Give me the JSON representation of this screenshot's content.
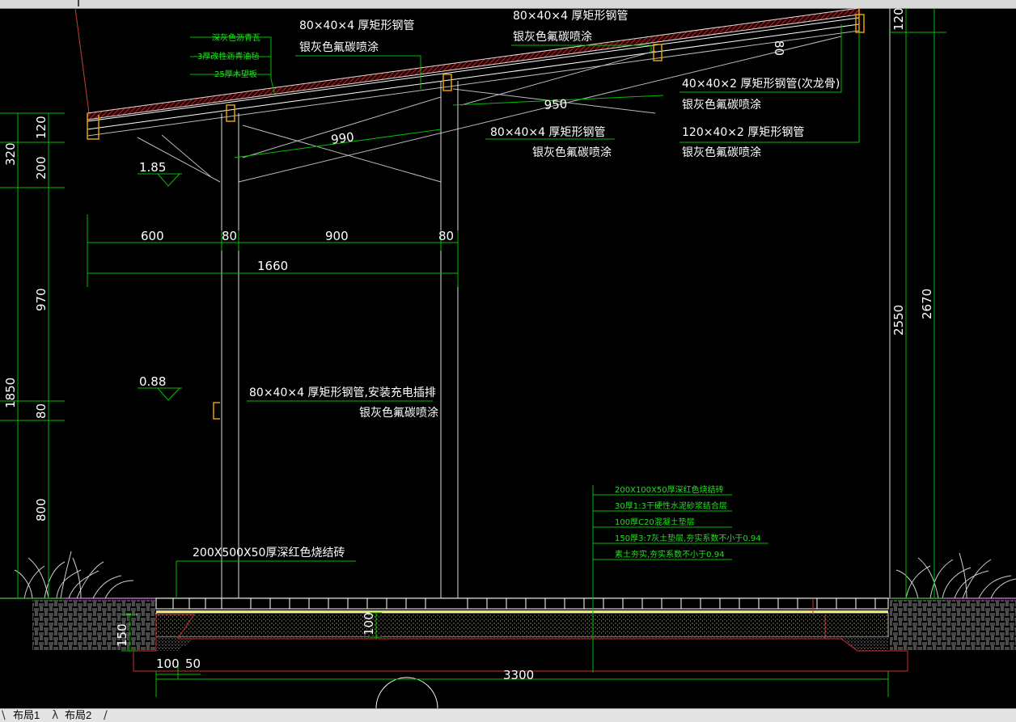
{
  "labels": {
    "roof_layer1": "深灰色沥青瓦",
    "roof_layer2": "3厚改性沥青油毡",
    "roof_layer3": "25厚木望板",
    "tube_main_top_left": "80×40×4 厚矩形钢管",
    "tube_main_top_left_sub": "银灰色氟碳喷涂",
    "tube_main_top_right": "80×40×4 厚矩形钢管",
    "tube_main_top_right_sub": "银灰色氟碳喷涂",
    "tube_secondary": "40×40×2 厚矩形钢管(次龙骨)",
    "tube_secondary_sub": "银灰色氟碳喷涂",
    "tube_mid": "80×40×4 厚矩形钢管",
    "tube_mid_sub": "银灰色氟碳喷涂",
    "tube_big": "120×40×2 厚矩形钢管",
    "tube_big_sub": "银灰色氟碳喷涂",
    "tube_socket": "80×40×4 厚矩形钢管,安装充电插排",
    "tube_socket_sub": "银灰色氟碳喷涂",
    "paving_brick": "200X500X50厚深红色烧结砖",
    "floor_layer1": "200X100X50厚深红色烧结砖",
    "floor_layer2": "30厚1:3干硬性水泥砂浆结合层",
    "floor_layer3": "100厚C20混凝土垫层",
    "floor_layer4": "150厚3:7灰土垫层,夯实系数不小于0.94",
    "floor_layer5": "素土夯实,夯实系数不小于0.94"
  },
  "elevations": {
    "e1": "1.85",
    "e2": "0.88"
  },
  "dims": {
    "d320": "320",
    "d120": "120",
    "d200": "200",
    "d970": "970",
    "d1850": "1850",
    "d80": "80",
    "d800": "800",
    "d600": "600",
    "d80a": "80",
    "d900": "900",
    "d80b": "80",
    "d1660": "1660",
    "d990": "990",
    "d950": "950",
    "d80roof": "80",
    "d120top": "120",
    "d2550": "2550",
    "d2670": "2670",
    "d150": "150",
    "d100": "100",
    "d100b": "100",
    "d50": "50",
    "d3300": "3300"
  },
  "tabs": {
    "layout1": "布局1",
    "layout2": "布局2"
  }
}
